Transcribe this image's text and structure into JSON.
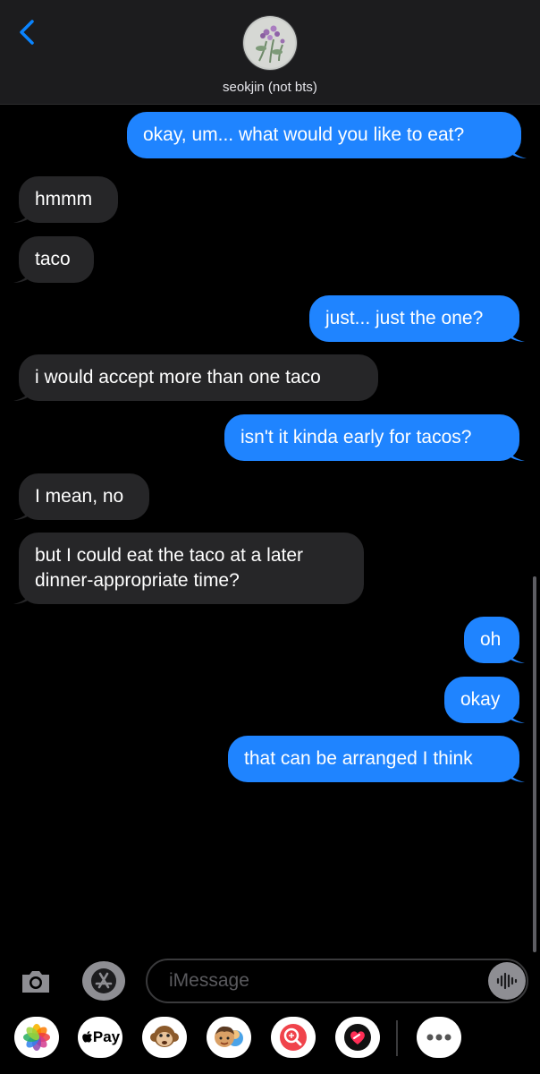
{
  "header": {
    "contact_name": "seokjin (not bts)"
  },
  "messages": [
    {
      "dir": "out",
      "text": "okay, um... what would you like to eat?"
    },
    {
      "dir": "in",
      "text": "hmmm"
    },
    {
      "dir": "in",
      "text": "taco"
    },
    {
      "dir": "out",
      "text": "just... just the one?"
    },
    {
      "dir": "in",
      "text": "i would accept more than one taco"
    },
    {
      "dir": "out",
      "text": "isn't it kinda early for tacos?"
    },
    {
      "dir": "in",
      "text": "I mean, no"
    },
    {
      "dir": "in",
      "line1": "but I could eat the taco at a later",
      "line2": "dinner-appropriate time?"
    },
    {
      "dir": "out",
      "text": "oh"
    },
    {
      "dir": "out",
      "text": "okay"
    },
    {
      "dir": "out",
      "text": "that can be arranged I think"
    }
  ],
  "composer": {
    "placeholder": "iMessage"
  },
  "app_drawer": {
    "apple_pay_label": "Pay"
  },
  "colors": {
    "outgoing": "#1f84ff",
    "incoming": "#262628",
    "accent": "#0a84ff"
  }
}
